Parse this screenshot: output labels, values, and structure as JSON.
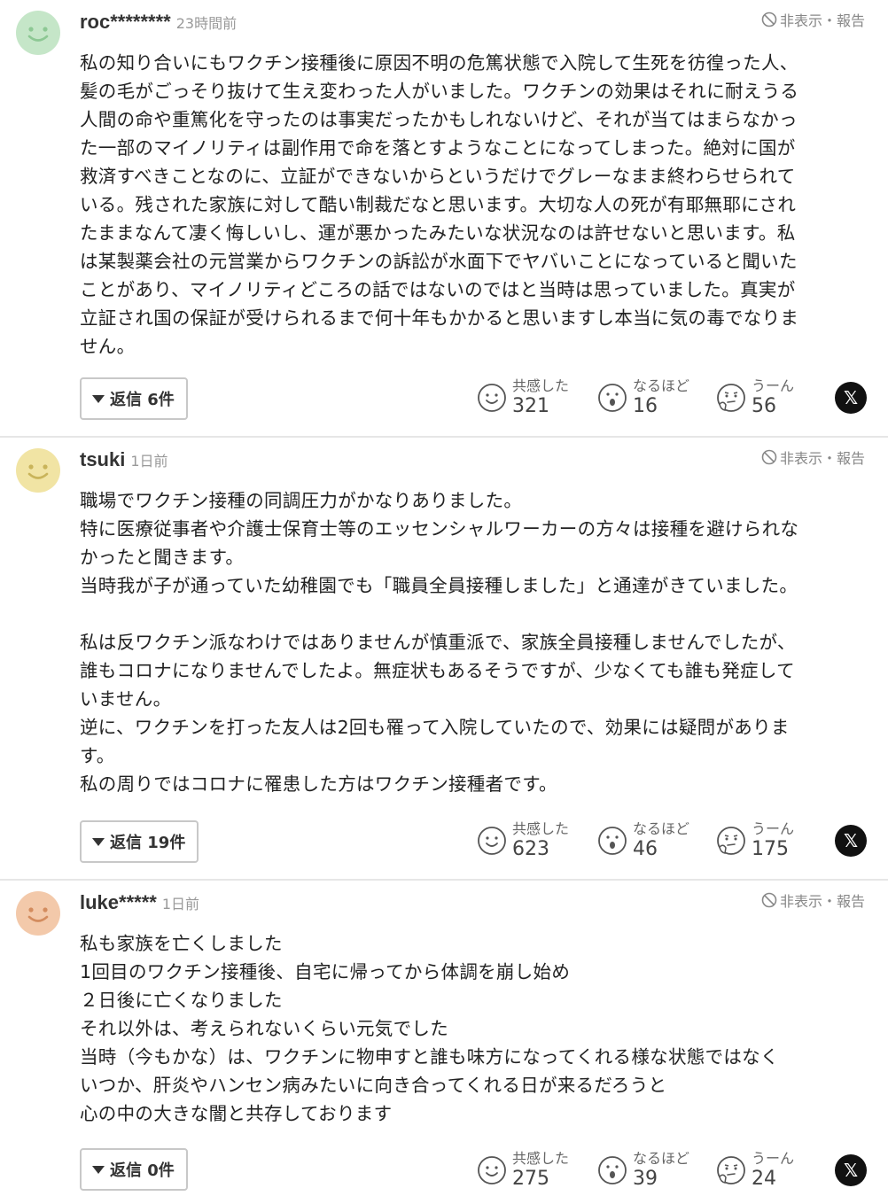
{
  "colors": {
    "avatar_green": "#c5e6c8",
    "avatar_yellow": "#f1e4a4",
    "avatar_peach": "#f3c9aa",
    "divider": "#e6e6e6"
  },
  "icons": {
    "report": "ban-icon",
    "reply": "triangle-down-icon",
    "empathy": "smile-icon",
    "indeed": "surprised-icon",
    "hmm": "thinking-icon",
    "share": "x-logo-icon"
  },
  "comments": [
    {
      "user": "roc********",
      "time": "23時間前",
      "report_label": "非表示・報告",
      "lines": [
        "私の知り合いにもワクチン接種後に原因不明の危篤状態で入院して生死を彷徨った人、",
        "髪の毛がごっそり抜けて生え変わった人がいました。ワクチンの効果はそれに耐えうる",
        "人間の命や重篤化を守ったのは事実だったかもしれないけど、それが当てはまらなかっ",
        "た一部のマイノリティは副作用で命を落とすようなことになってしまった。絶対に国が",
        "救済すべきことなのに、立証ができないからというだけでグレーなまま終わらせられて",
        "いる。残された家族に対して酷い制裁だなと思います。大切な人の死が有耶無耶にされ",
        "たままなんて凄く悔しいし、運が悪かったみたいな状況なのは許せないと思います。私",
        "は某製薬会社の元営業からワクチンの訴訟が水面下でヤバいことになっていると聞いた",
        "ことがあり、マイノリティどころの話ではないのではと当時は思っていました。真実が",
        "立証され国の保証が受けられるまで何十年もかかると思いますし本当に気の毒でなりま",
        "せん。"
      ],
      "reply_label": "返信 6件",
      "reactions": [
        {
          "label": "共感した",
          "count": "321"
        },
        {
          "label": "なるほど",
          "count": "16"
        },
        {
          "label": "うーん",
          "count": "56"
        }
      ]
    },
    {
      "user": "tsuki",
      "time": "1日前",
      "report_label": "非表示・報告",
      "lines": [
        "職場でワクチン接種の同調圧力がかなりありました。",
        "特に医療従事者や介護士保育士等のエッセンシャルワーカーの方々は接種を避けられな",
        "かったと聞きます。",
        "当時我が子が通っていた幼稚園でも「職員全員接種しました」と通達がきていました。",
        "",
        "私は反ワクチン派なわけではありませんが慎重派で、家族全員接種しませんでしたが、",
        "誰もコロナになりませんでしたよ。無症状もあるそうですが、少なくても誰も発症して",
        "いません。",
        "逆に、ワクチンを打った友人は2回も罹って入院していたので、効果には疑問がありま",
        "す。",
        "私の周りではコロナに罹患した方はワクチン接種者です。"
      ],
      "reply_label": "返信 19件",
      "reactions": [
        {
          "label": "共感した",
          "count": "623"
        },
        {
          "label": "なるほど",
          "count": "46"
        },
        {
          "label": "うーん",
          "count": "175"
        }
      ]
    },
    {
      "user": "luke*****",
      "time": "1日前",
      "report_label": "非表示・報告",
      "lines": [
        "私も家族を亡くしました",
        "1回目のワクチン接種後、自宅に帰ってから体調を崩し始め",
        "２日後に亡くなりました",
        "それ以外は、考えられないくらい元気でした",
        "当時（今もかな）は、ワクチンに物申すと誰も味方になってくれる様な状態ではなく",
        "いつか、肝炎やハンセン病みたいに向き合ってくれる日が来るだろうと",
        "心の中の大きな闇と共存しております"
      ],
      "reply_label": "返信 0件",
      "reactions": [
        {
          "label": "共感した",
          "count": "275"
        },
        {
          "label": "なるほど",
          "count": "39"
        },
        {
          "label": "うーん",
          "count": "24"
        }
      ]
    }
  ]
}
